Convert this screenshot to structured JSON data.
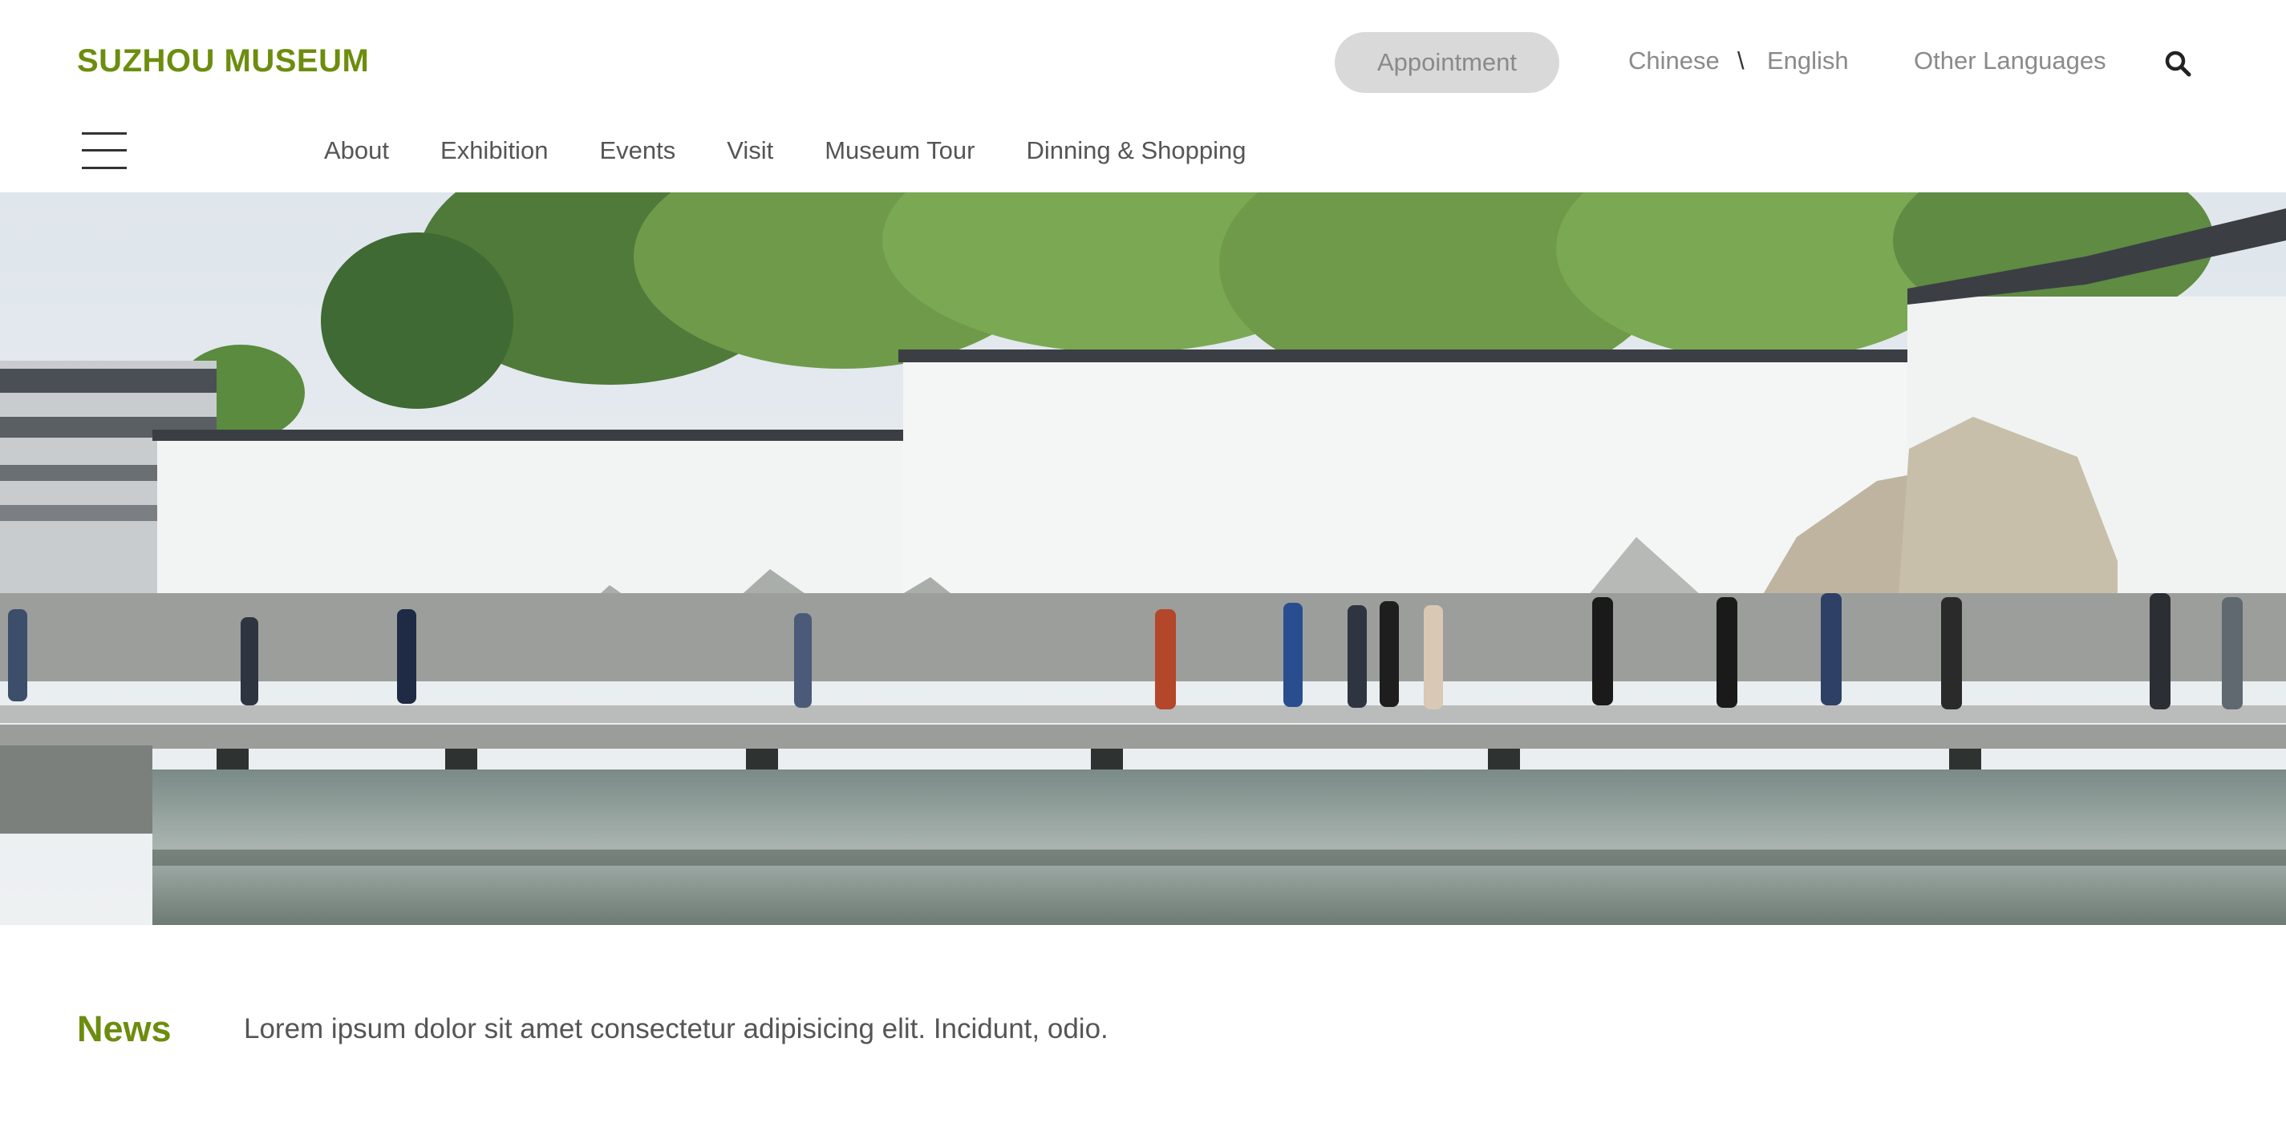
{
  "site": {
    "title": "SUZHOU MUSEUM",
    "brand_color": "#6d8d0e"
  },
  "header": {
    "appointment_label": "Appointment",
    "languages": {
      "chinese": "Chinese",
      "separator": "\\",
      "english": "English",
      "other": "Other Languages"
    },
    "icons": {
      "search": "search-icon",
      "menu": "hamburger-menu-icon"
    }
  },
  "nav": {
    "items": [
      {
        "label": "About"
      },
      {
        "label": "Exhibition"
      },
      {
        "label": "Events"
      },
      {
        "label": "Visit"
      },
      {
        "label": "Museum Tour"
      },
      {
        "label": "Dinning & Shopping"
      }
    ]
  },
  "news": {
    "label": "News",
    "headline": "Lorem ipsum dolor sit amet consectetur adipisicing elit. Incidunt, odio."
  }
}
